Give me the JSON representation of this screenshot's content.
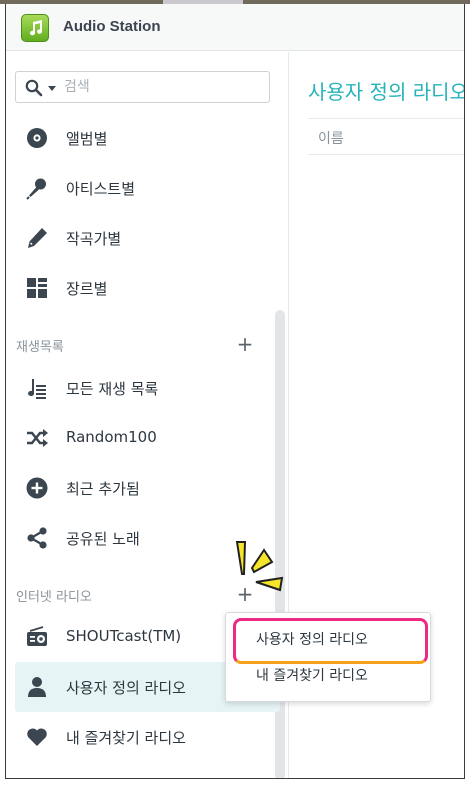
{
  "app": {
    "title": "Audio Station"
  },
  "search": {
    "placeholder": "검색"
  },
  "library": [
    {
      "label": "앨범별",
      "icon": "album-icon"
    },
    {
      "label": "아티스트별",
      "icon": "microphone-icon"
    },
    {
      "label": "작곡가별",
      "icon": "pen-icon"
    },
    {
      "label": "장르별",
      "icon": "grid-icon"
    }
  ],
  "playlists": {
    "header": "재생목록",
    "items": [
      {
        "label": "모든 재생 목록",
        "icon": "playlist-icon"
      },
      {
        "label": "Random100",
        "icon": "shuffle-icon"
      },
      {
        "label": "최근 추가됨",
        "icon": "plus-circle-icon"
      },
      {
        "label": "공유된 노래",
        "icon": "share-icon"
      }
    ]
  },
  "radio": {
    "header": "인터넷 라디오",
    "items": [
      {
        "label": "SHOUTcast(TM)",
        "icon": "radio-icon"
      },
      {
        "label": "사용자 정의 라디오",
        "icon": "user-icon",
        "selected": true
      },
      {
        "label": "내 즐겨찾기 라디오",
        "icon": "heart-icon"
      }
    ]
  },
  "main": {
    "title": "사용자 정의 라디오",
    "column_header": "이름"
  },
  "popup_menu": {
    "items": [
      "사용자 정의 라디오",
      "내 즐겨찾기 라디오"
    ],
    "highlighted_index": 0
  },
  "colors": {
    "accent": "#25b4b9",
    "selected_bg": "#e6f4f6",
    "highlight_frame_top": "#ec2a86",
    "highlight_frame_bottom": "#f6a11b"
  }
}
